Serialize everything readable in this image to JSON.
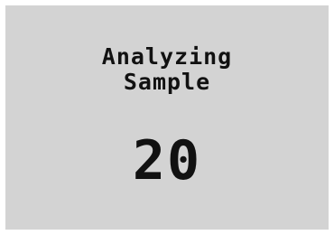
{
  "status": {
    "line1": "Analyzing",
    "line2": "Sample"
  },
  "counter": {
    "value": "20"
  },
  "colors": {
    "screen_bg": "#d3d3d3",
    "text": "#111111"
  }
}
